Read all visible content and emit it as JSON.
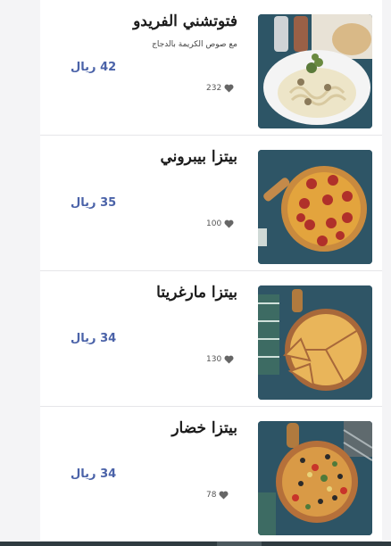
{
  "items": [
    {
      "title": "فتوتشني الفريدو",
      "description": "مع صوص الكريمة بالدجاج",
      "price": "42 ريال",
      "likes": "232",
      "image": "fettuccine-plate"
    },
    {
      "title": "بيتزا بيبروني",
      "description": "",
      "price": "35 ريال",
      "likes": "100",
      "image": "pepperoni-pizza"
    },
    {
      "title": "بيتزا مارغريتا",
      "description": "",
      "price": "34 ريال",
      "likes": "130",
      "image": "margherita-pizza"
    },
    {
      "title": "بيتزا خضار",
      "description": "",
      "price": "34 ريال",
      "likes": "78",
      "image": "veggie-pizza"
    }
  ],
  "colors": {
    "accent": "#4a62a8",
    "title": "#1b1b1b",
    "heart": "#666666"
  }
}
